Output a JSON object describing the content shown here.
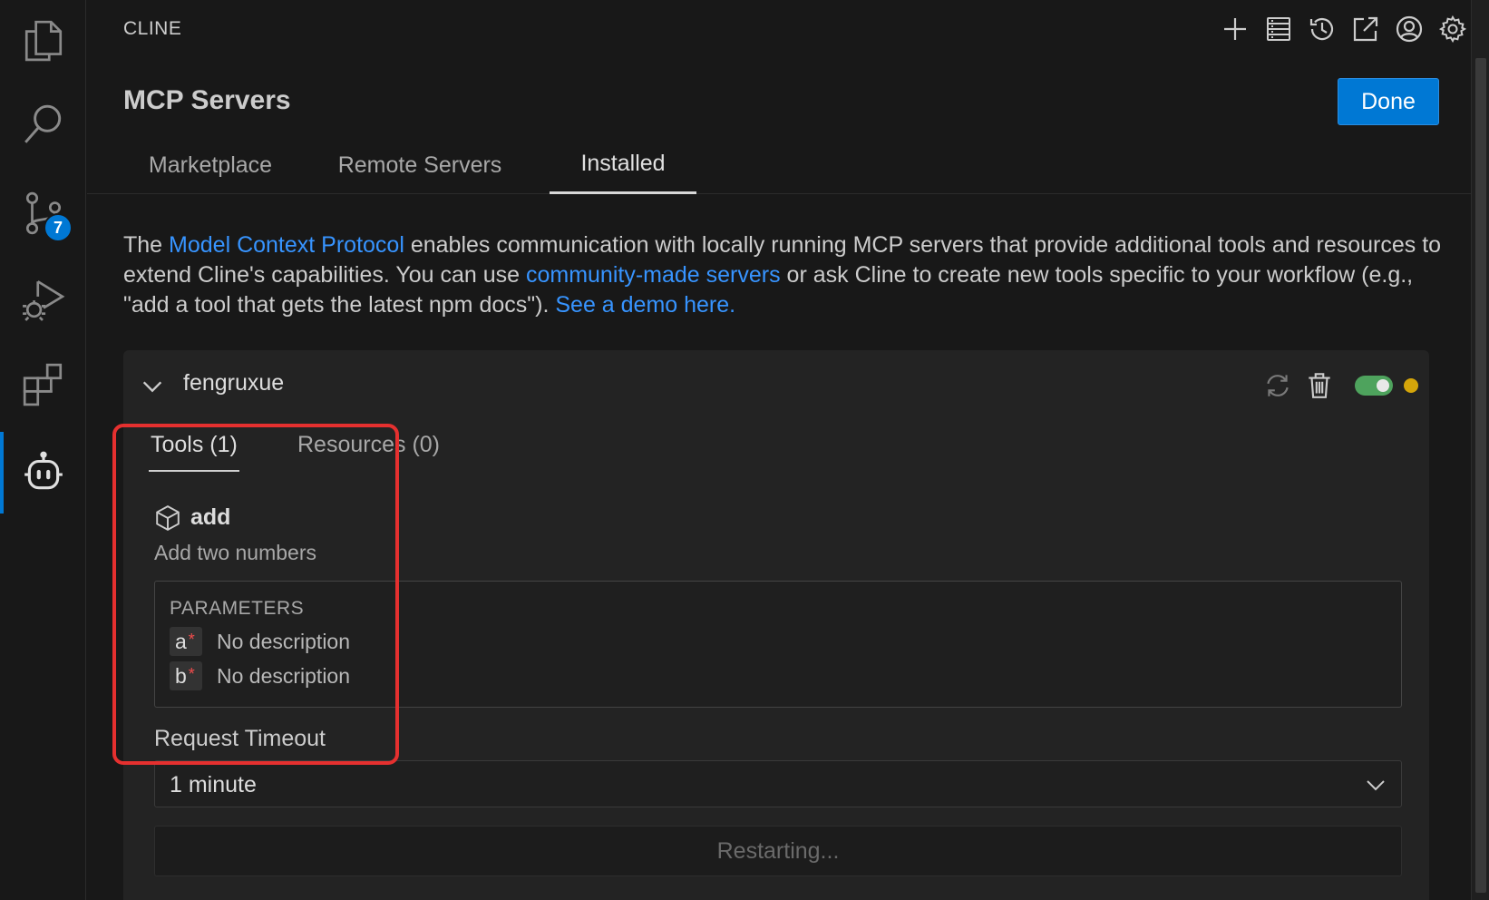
{
  "activity_bar": {
    "items": [
      {
        "name": "explorer-icon"
      },
      {
        "name": "search-icon"
      },
      {
        "name": "source-control-icon",
        "badge": "7"
      },
      {
        "name": "run-debug-icon"
      },
      {
        "name": "extensions-icon"
      },
      {
        "name": "cline-robot-icon",
        "active": true
      }
    ]
  },
  "header": {
    "title": "CLINE",
    "actions": [
      "plus-icon",
      "mcp-servers-icon",
      "history-icon",
      "open-external-icon",
      "account-icon",
      "gear-icon"
    ]
  },
  "page": {
    "title": "MCP Servers",
    "done_label": "Done"
  },
  "tabs": [
    {
      "label": "Marketplace",
      "active": false
    },
    {
      "label": "Remote Servers",
      "active": false
    },
    {
      "label": "Installed",
      "active": true
    }
  ],
  "intro": {
    "t1": "The ",
    "link1": "Model Context Protocol",
    "t2": " enables communication with locally running MCP servers that provide additional tools and resources to extend Cline's capabilities. You can use ",
    "link2": "community-made servers",
    "t3": " or ask Cline to create new tools specific to your workflow (e.g., \"add a tool that gets the latest npm docs\"). ",
    "link3": "See a demo here."
  },
  "server": {
    "name": "fengruxue",
    "enabled": true,
    "status_color": "#d4a50a",
    "tabs": [
      {
        "label": "Tools (1)",
        "active": true
      },
      {
        "label": "Resources (0)",
        "active": false
      }
    ],
    "tool": {
      "name": "add",
      "description": "Add two numbers",
      "parameters_label": "PARAMETERS",
      "parameters": [
        {
          "name": "a",
          "required": "*",
          "description": "No description"
        },
        {
          "name": "b",
          "required": "*",
          "description": "No description"
        }
      ]
    },
    "timeout_label": "Request Timeout",
    "timeout_value": "1 minute",
    "restart_label": "Restarting..."
  },
  "colors": {
    "accent": "#0078d4",
    "link": "#3794ff",
    "highlight": "#e5302f",
    "toggle_on": "#4ea35d"
  }
}
